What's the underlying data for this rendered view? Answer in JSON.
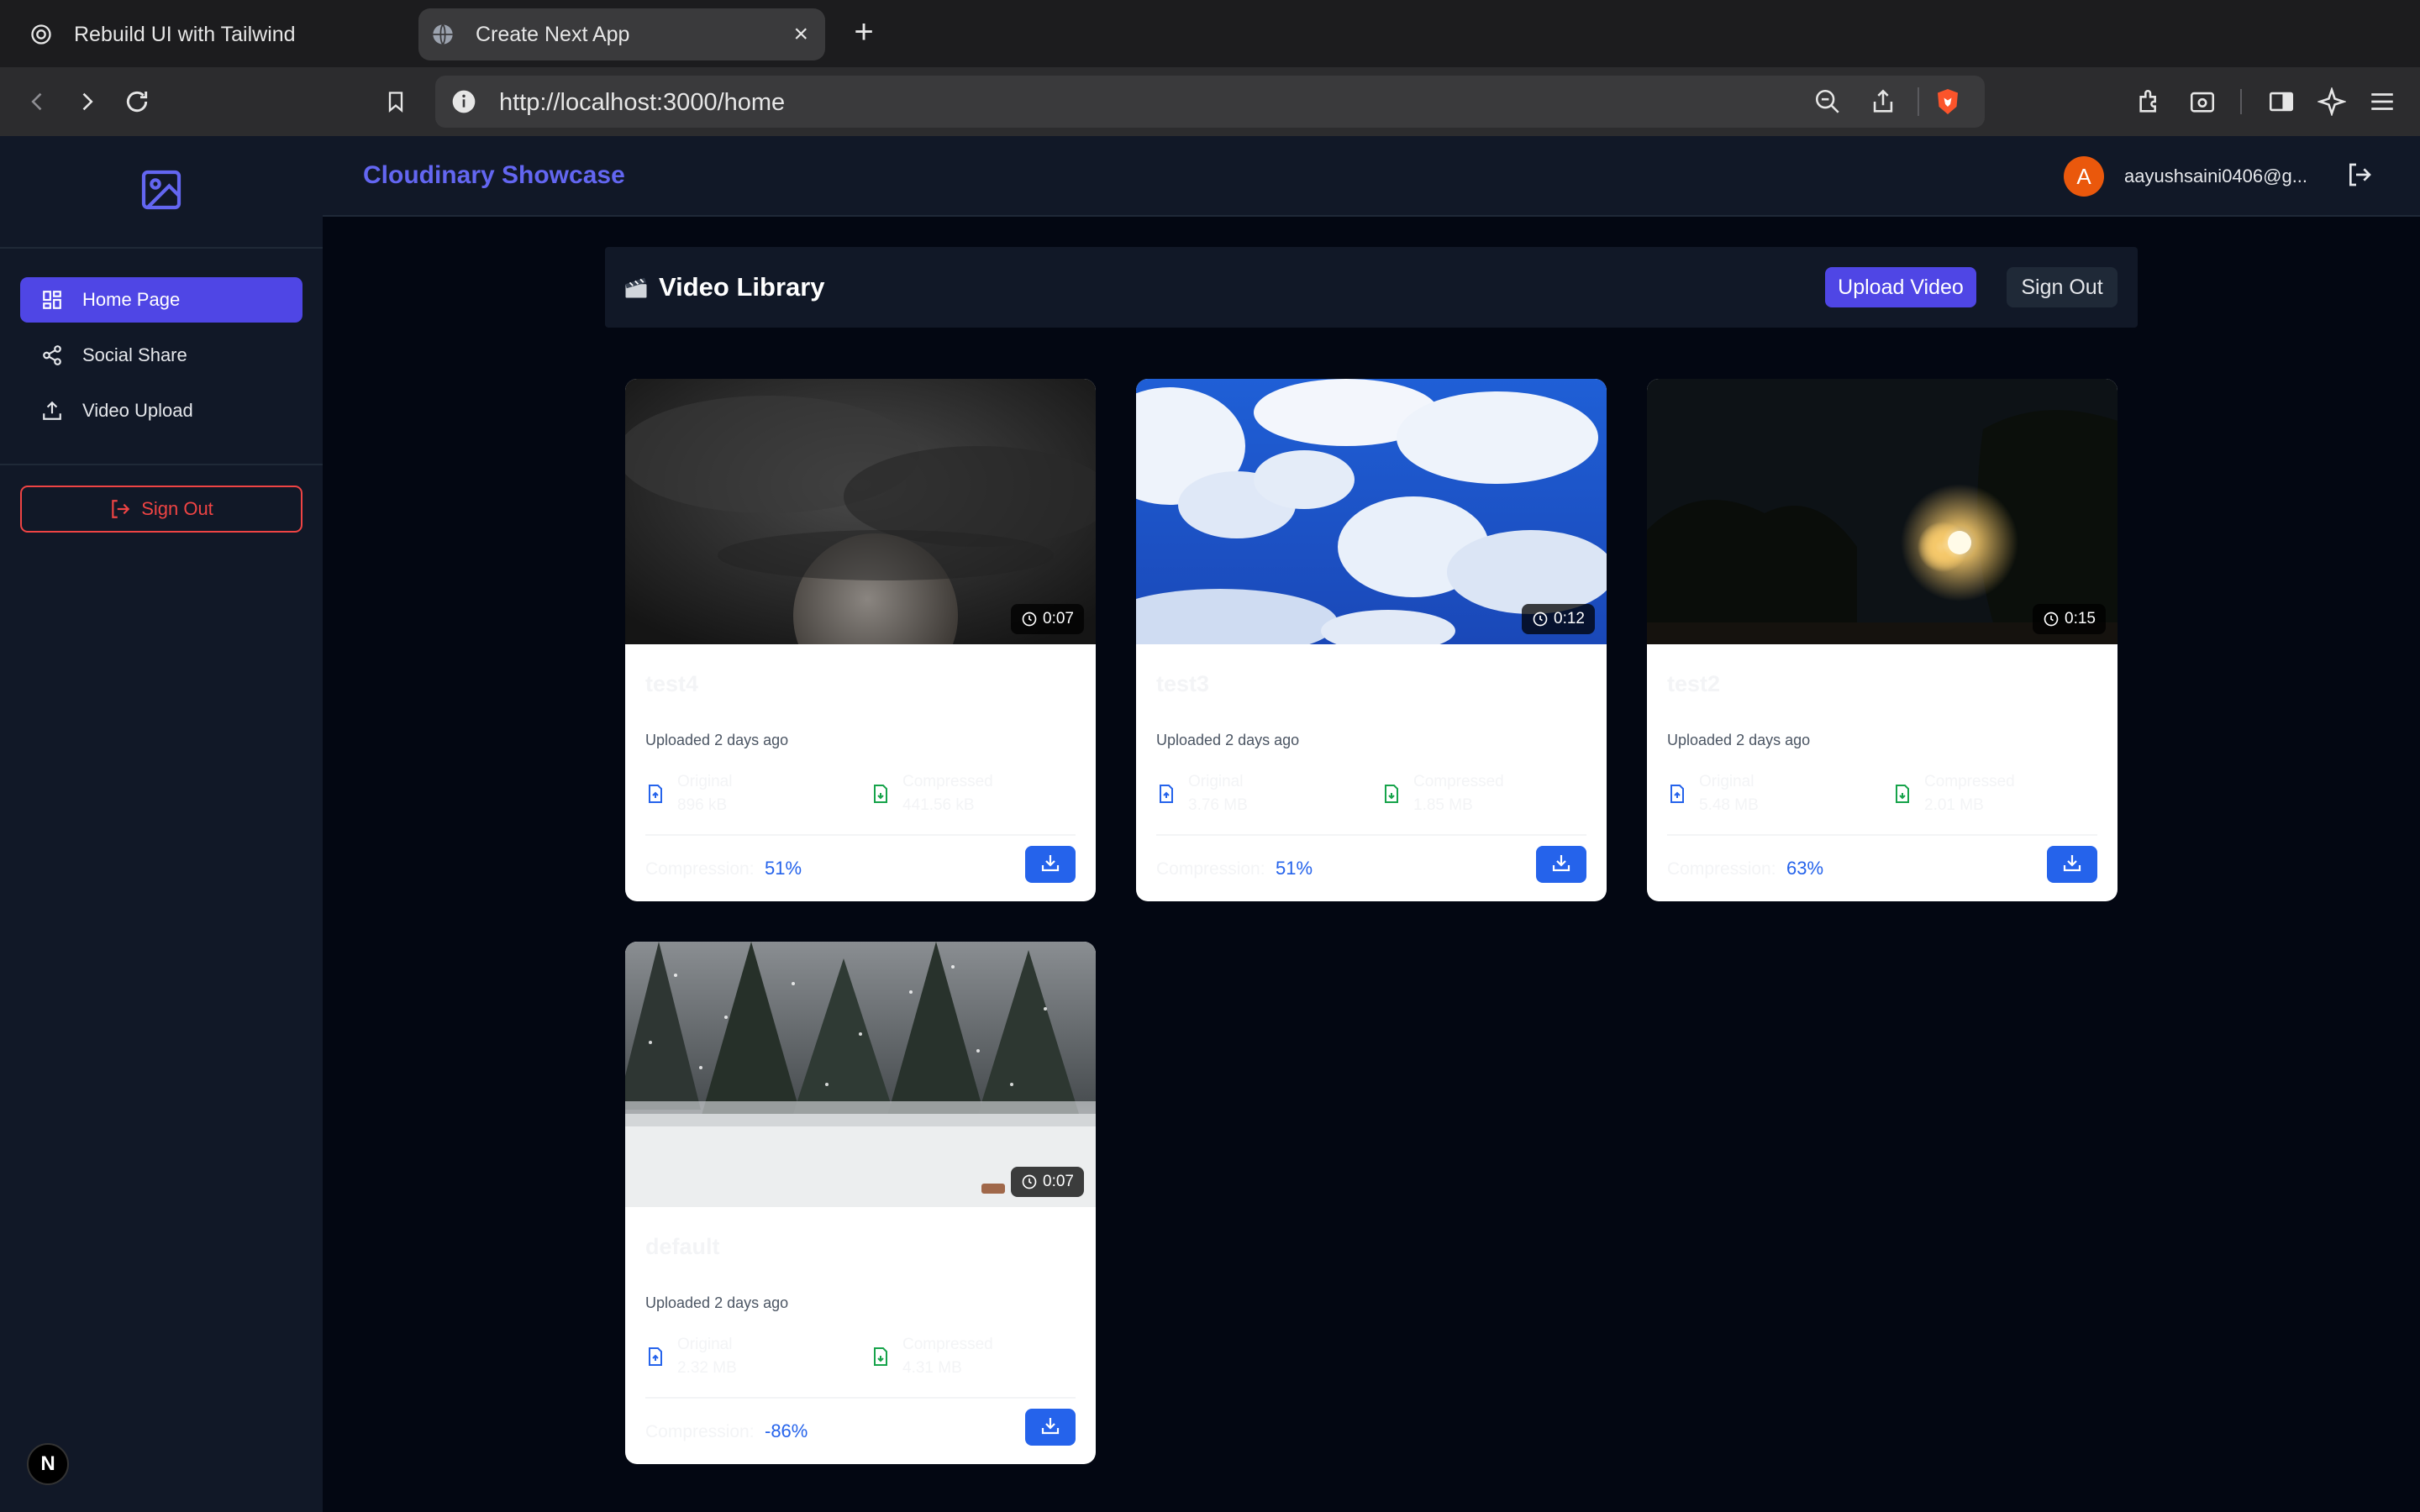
{
  "browser": {
    "tabs": [
      {
        "title": "Rebuild UI with Tailwind",
        "active": false
      },
      {
        "title": "Create Next App",
        "active": true
      }
    ],
    "url": "http://localhost:3000/home"
  },
  "sidebar": {
    "items": [
      {
        "label": "Home Page",
        "icon": "grid-icon",
        "active": true
      },
      {
        "label": "Social Share",
        "icon": "share-icon",
        "active": false
      },
      {
        "label": "Video Upload",
        "icon": "upload-icon",
        "active": false
      }
    ],
    "signout_label": "Sign Out",
    "badge": "N"
  },
  "header": {
    "brand": "Cloudinary Showcase",
    "avatar_letter": "A",
    "email": "aayushsaini0406@g..."
  },
  "library": {
    "title": "Video Library",
    "upload_label": "Upload Video",
    "signout_label": "Sign Out"
  },
  "videos": [
    {
      "title": "test4",
      "duration": "0:07",
      "uploaded": "Uploaded 2 days ago",
      "original_label": "Original",
      "original_size": "896 kB",
      "compressed_label": "Compressed",
      "compressed_size": "441.56 kB",
      "compression_label": "Compression:",
      "compression_value": "51%",
      "thumb": "moon-clouds"
    },
    {
      "title": "test3",
      "duration": "0:12",
      "uploaded": "Uploaded 2 days ago",
      "original_label": "Original",
      "original_size": "3.76 MB",
      "compressed_label": "Compressed",
      "compressed_size": "1.85 MB",
      "compression_label": "Compression:",
      "compression_value": "51%",
      "thumb": "blue-sky"
    },
    {
      "title": "test2",
      "duration": "0:15",
      "uploaded": "Uploaded 2 days ago",
      "original_label": "Original",
      "original_size": "5.48 MB",
      "compressed_label": "Compressed",
      "compressed_size": "2.01 MB",
      "compression_label": "Compression:",
      "compression_value": "63%",
      "thumb": "night-streetlight"
    },
    {
      "title": "default",
      "duration": "0:07",
      "uploaded": "Uploaded 2 days ago",
      "original_label": "Original",
      "original_size": "2.32 MB",
      "compressed_label": "Compressed",
      "compressed_size": "4.31 MB",
      "compression_label": "Compression:",
      "compression_value": "-86%",
      "thumb": "snowy-forest"
    }
  ],
  "colors": {
    "accent": "#4f46e5",
    "brand": "#6366f1",
    "danger": "#ef4444",
    "download": "#2563eb",
    "background": "#030712",
    "panel": "#111827"
  }
}
